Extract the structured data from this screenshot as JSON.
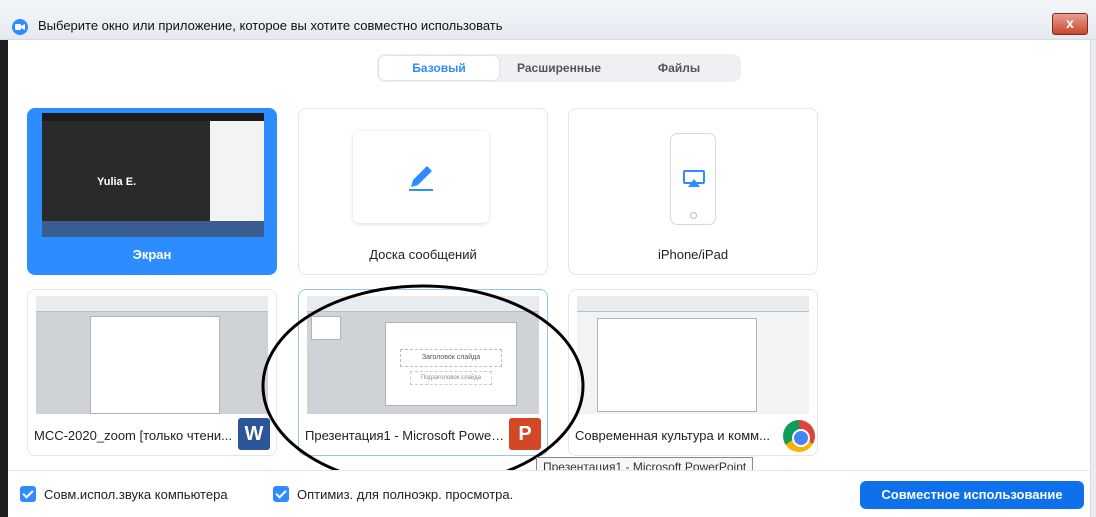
{
  "window": {
    "title": "Выберите окно или приложение, которое вы хотите совместно использовать",
    "close_label": "x"
  },
  "tabs": [
    {
      "label": "Базовый",
      "active": true
    },
    {
      "label": "Расширенные",
      "active": false
    },
    {
      "label": "Файлы",
      "active": false
    }
  ],
  "tiles": {
    "screen": {
      "label": "Экран",
      "participant": "Yulia E.",
      "selected": true
    },
    "whiteboard": {
      "label": "Доска сообщений"
    },
    "iphone": {
      "label": "iPhone/iPad"
    },
    "word": {
      "label": "MCC-2020_zoom [только чтени...",
      "app_icon": "word-icon"
    },
    "powerpoint": {
      "label": "Презентация1 - Microsoft Power...",
      "app_icon": "powerpoint-icon",
      "slide_title": "Заголовок слайда",
      "slide_subtitle": "Подзаголовок слайда"
    },
    "chrome": {
      "label": "Современная культура и комм...",
      "app_icon": "chrome-icon"
    }
  },
  "tooltip": "Презентация1 - Microsoft PowerPoint",
  "options": {
    "share_audio": {
      "label": "Совм.испол.звука компьютера",
      "checked": true
    },
    "optimize_video": {
      "label": "Оптимиз. для полноэкр. просмотра.",
      "checked": true
    }
  },
  "share_button": "Совместное использование",
  "colors": {
    "accent": "#2d8cff",
    "share_button": "#0e71eb"
  }
}
